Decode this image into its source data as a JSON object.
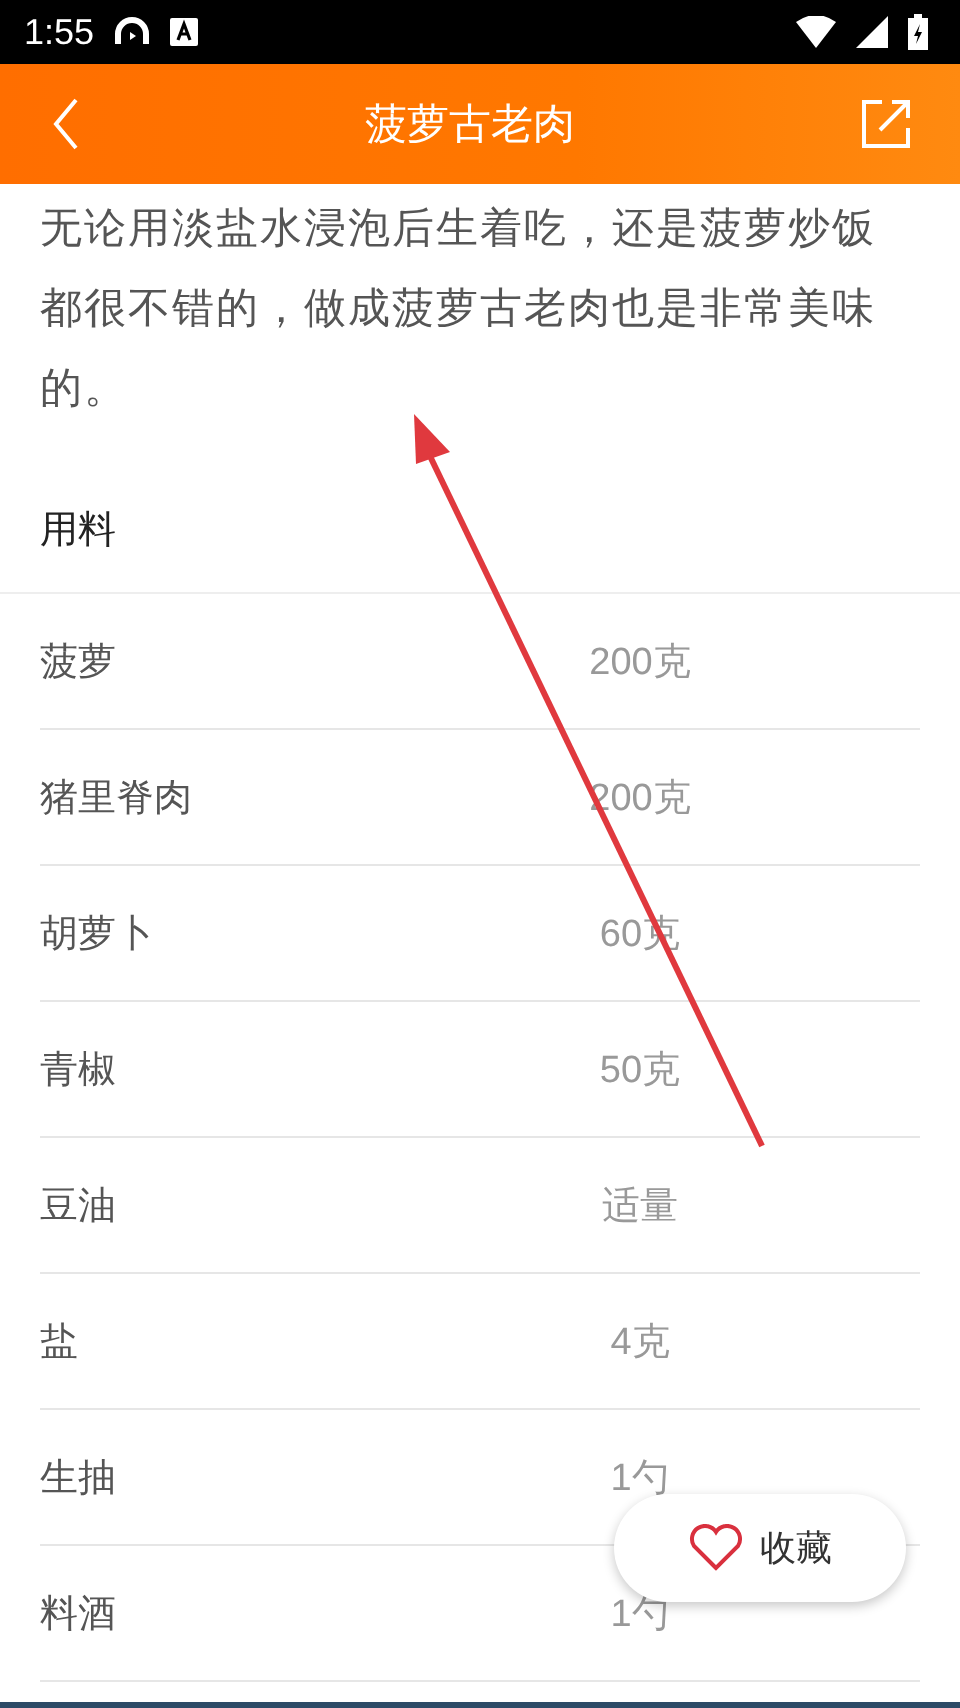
{
  "status_bar": {
    "time": "1:55"
  },
  "header": {
    "title": "菠萝古老肉"
  },
  "description": "无论用淡盐水浸泡后生着吃，还是菠萝炒饭都很不错的，做成菠萝古老肉也是非常美味的。",
  "ingredients": {
    "heading": "用料",
    "rows": [
      {
        "name": "菠萝",
        "amount": "200克"
      },
      {
        "name": "猪里脊肉",
        "amount": "200克"
      },
      {
        "name": "胡萝卜",
        "amount": "60克"
      },
      {
        "name": "青椒",
        "amount": "50克"
      },
      {
        "name": "豆油",
        "amount": "适量"
      },
      {
        "name": "盐",
        "amount": "4克"
      },
      {
        "name": "生抽",
        "amount": "1勺"
      },
      {
        "name": "料酒",
        "amount": "1勺"
      }
    ]
  },
  "favorite_button": {
    "label": "收藏"
  }
}
